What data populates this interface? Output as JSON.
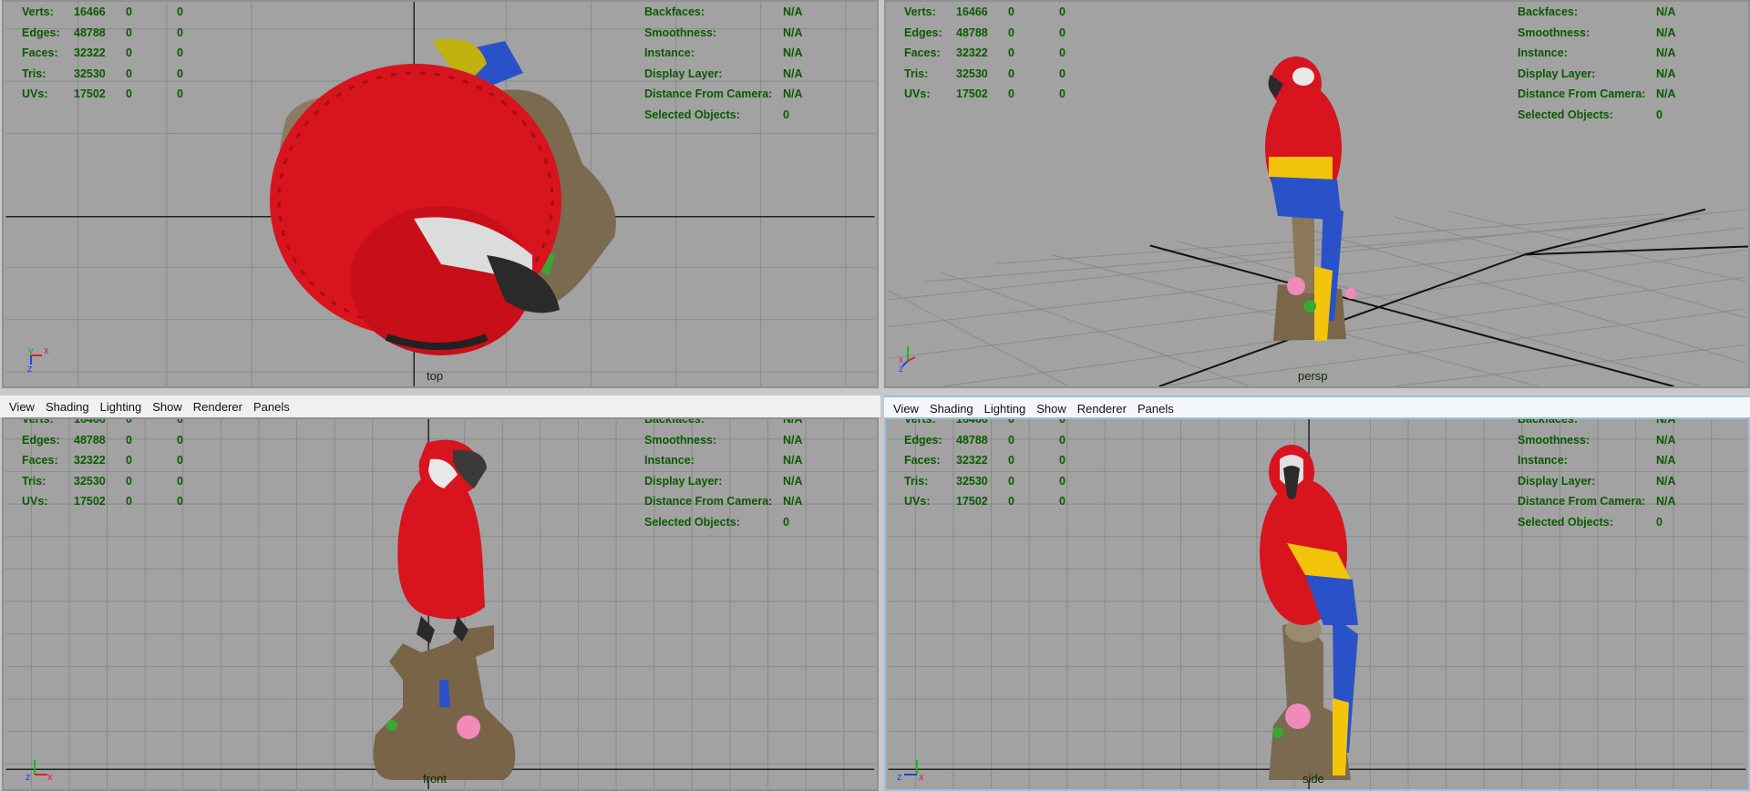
{
  "menu": [
    "View",
    "Shading",
    "Lighting",
    "Show",
    "Renderer",
    "Panels"
  ],
  "stats_left": [
    {
      "label": "Verts:",
      "v1": "16466",
      "v2": "0",
      "v3": "0"
    },
    {
      "label": "Edges:",
      "v1": "48788",
      "v2": "0",
      "v3": "0"
    },
    {
      "label": "Faces:",
      "v1": "32322",
      "v2": "0",
      "v3": "0"
    },
    {
      "label": "Tris:",
      "v1": "32530",
      "v2": "0",
      "v3": "0"
    },
    {
      "label": "UVs:",
      "v1": "17502",
      "v2": "0",
      "v3": "0"
    }
  ],
  "stats_right": [
    {
      "label": "Backfaces:",
      "value": "N/A"
    },
    {
      "label": "Smoothness:",
      "value": "N/A"
    },
    {
      "label": "Instance:",
      "value": "N/A"
    },
    {
      "label": "Display Layer:",
      "value": "N/A"
    },
    {
      "label": "Distance From Camera:",
      "value": "N/A"
    },
    {
      "label": "Selected Objects:",
      "value": "0"
    }
  ],
  "views": {
    "top": {
      "camera": "top"
    },
    "persp": {
      "camera": "persp"
    },
    "front": {
      "camera": "front"
    },
    "side": {
      "camera": "side"
    }
  },
  "axis_labels": {
    "x": "x",
    "y": "y",
    "z": "z"
  },
  "colors": {
    "viewport_bg": "#a2a2a2",
    "hud_text": "#0a5a00",
    "parrot_red": "#d8141e",
    "parrot_yellow": "#f2c40c",
    "parrot_blue": "#2a52c8"
  }
}
